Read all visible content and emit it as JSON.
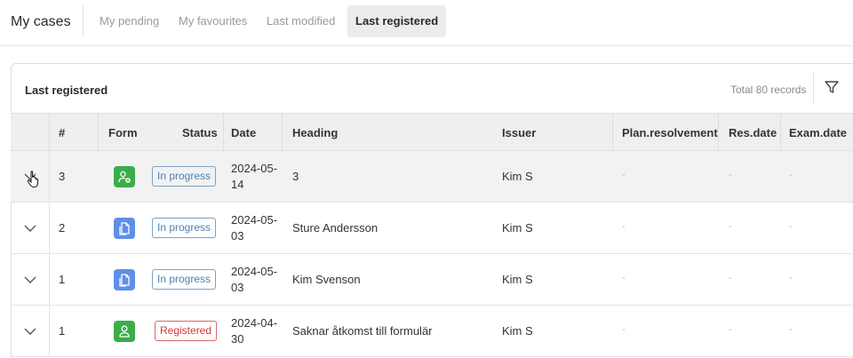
{
  "app": {
    "title": "My cases"
  },
  "tabs": [
    {
      "label": "My pending",
      "active": false
    },
    {
      "label": "My favourites",
      "active": false
    },
    {
      "label": "Last modified",
      "active": false
    },
    {
      "label": "Last registered",
      "active": true
    }
  ],
  "card": {
    "title": "Last registered",
    "total": "Total 80 records",
    "filter_icon": "filter-icon"
  },
  "columns": [
    "#",
    "Form",
    "Status",
    "Date",
    "Heading",
    "Issuer",
    "Plan.resolvement",
    "Res.date",
    "Exam.date"
  ],
  "rows": [
    {
      "num": "3",
      "form_icon": "user-add-icon",
      "form_color": "#3aad4a",
      "status": "In progress",
      "status_type": "progress",
      "date": "2024-05-14",
      "heading": "3",
      "issuer": "Kim S",
      "plan": "-",
      "res": "-",
      "exam": "-",
      "hovered": true
    },
    {
      "num": "2",
      "form_icon": "document-icon",
      "form_color": "#5f8fe8",
      "status": "In progress",
      "status_type": "progress",
      "date": "2024-05-03",
      "heading": "Sture Andersson",
      "issuer": "Kim S",
      "plan": "-",
      "res": "-",
      "exam": "-",
      "hovered": false
    },
    {
      "num": "1",
      "form_icon": "document-icon",
      "form_color": "#5f8fe8",
      "status": "In progress",
      "status_type": "progress",
      "date": "2024-05-03",
      "heading": "Kim Svenson",
      "issuer": "Kim S",
      "plan": "-",
      "res": "-",
      "exam": "-",
      "hovered": false
    },
    {
      "num": "1",
      "form_icon": "user-icon",
      "form_color": "#3aad4a",
      "status": "Registered",
      "status_type": "registered",
      "date": "2024-04-30",
      "heading": "Saknar åtkomst till formulär",
      "issuer": "Kim S",
      "plan": "-",
      "res": "-",
      "exam": "-",
      "hovered": false
    }
  ]
}
